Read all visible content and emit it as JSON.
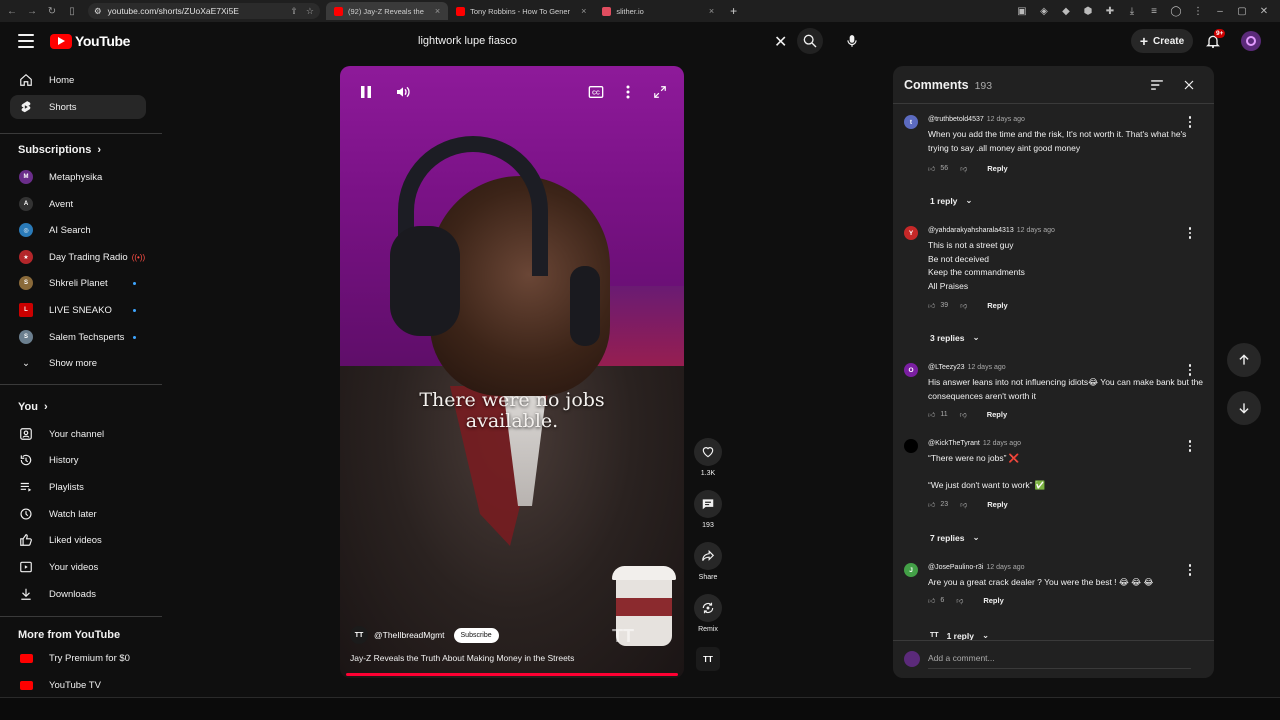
{
  "browser": {
    "url": "youtube.com/shorts/ZUoXaE7Xi5E",
    "tabs": [
      {
        "label": "(92) Jay-Z Reveals the",
        "active": true,
        "color": "#ff0000"
      },
      {
        "label": "Tony Robbins - How To Gener",
        "active": false,
        "color": "#ff0000"
      },
      {
        "label": "slither.io",
        "active": false,
        "color": "#e04d5f"
      }
    ]
  },
  "masthead": {
    "logo_text": "YouTube",
    "search_value": "lightwork lupe fiasco",
    "create_label": "Create",
    "notification_count": "9+"
  },
  "sidebar": {
    "main": [
      {
        "label": "Home",
        "icon": "home-icon"
      },
      {
        "label": "Shorts",
        "icon": "shorts-icon",
        "active": true
      }
    ],
    "subscriptions_title": "Subscriptions",
    "subscriptions": [
      {
        "label": "Metaphysika",
        "color": "#6a2d8a",
        "badge": ""
      },
      {
        "label": "Avent",
        "color": "#333333",
        "badge": ""
      },
      {
        "label": "AI Search",
        "color": "#2a7ab8",
        "badge": ""
      },
      {
        "label": "Day Trading Radio",
        "color": "#b3262a",
        "badge": "live"
      },
      {
        "label": "Shkreli Planet",
        "color": "#8a6a3a",
        "badge": "dot"
      },
      {
        "label": "LIVE SNEAKO",
        "color": "#cc0000",
        "badge": "dot"
      },
      {
        "label": "Salem Techsperts",
        "color": "#6b7f8f",
        "badge": "dot"
      }
    ],
    "show_more": "Show more",
    "you_title": "You",
    "you_items": [
      {
        "label": "Your channel",
        "icon": "person-icon"
      },
      {
        "label": "History",
        "icon": "history-icon"
      },
      {
        "label": "Playlists",
        "icon": "playlists-icon"
      },
      {
        "label": "Watch later",
        "icon": "clock-icon"
      },
      {
        "label": "Liked videos",
        "icon": "thumb-up-icon"
      },
      {
        "label": "Your videos",
        "icon": "video-icon"
      },
      {
        "label": "Downloads",
        "icon": "download-icon"
      }
    ],
    "more_title": "More from YouTube",
    "more_items": [
      {
        "label": "Try Premium for $0"
      },
      {
        "label": "YouTube TV"
      }
    ]
  },
  "video": {
    "caption_line1": "There were no jobs",
    "caption_line2": "available.",
    "channel_handle": "@TheIlbreadMgmt",
    "subscribe_label": "Subscribe",
    "title": "Jay-Z Reveals the Truth About Making Money in the Streets"
  },
  "actions": {
    "likes": "1.3K",
    "comments": "193",
    "share": "Share",
    "remix": "Remix"
  },
  "comments_panel": {
    "title": "Comments",
    "count": "193",
    "add_placeholder": "Add a comment...",
    "items": [
      {
        "avatar": "t",
        "color": "#5c6bc0",
        "author": "@truthbetold4537",
        "when": "12 days ago",
        "text": "When you add the time and the risk, It's not worth it. That's what he's trying to say .all money aint good money",
        "likes": "56",
        "replies": "1 reply"
      },
      {
        "avatar": "Y",
        "color": "#c62828",
        "author": "@yahdarakyahsharala4313",
        "when": "12 days ago",
        "text": "This is not a street guy\nBe not deceived\nKeep the commandments\nAll Praises",
        "likes": "39",
        "replies": "3 replies"
      },
      {
        "avatar": "O",
        "color": "#7b1fa2",
        "author": "@LTeezy23",
        "when": "12 days ago",
        "text": "His answer leans into not influencing idiots😂 You can make bank but the consequences aren't worth it",
        "likes": "11",
        "replies": ""
      },
      {
        "avatar": "",
        "color": "#000000",
        "author": "@KickTheTyrant",
        "when": "12 days ago",
        "text": "“There were no jobs” ❌\n\n“We just don't want to work” ✅",
        "likes": "23",
        "replies": "7 replies"
      },
      {
        "avatar": "J",
        "color": "#43a047",
        "author": "@JosePaulino-r3i",
        "when": "12 days ago",
        "text": "Are you a great crack dealer ? You were the best ! 😂 😂 😂",
        "likes": "6",
        "replies": "1 reply"
      }
    ],
    "reply_label": "Reply"
  }
}
